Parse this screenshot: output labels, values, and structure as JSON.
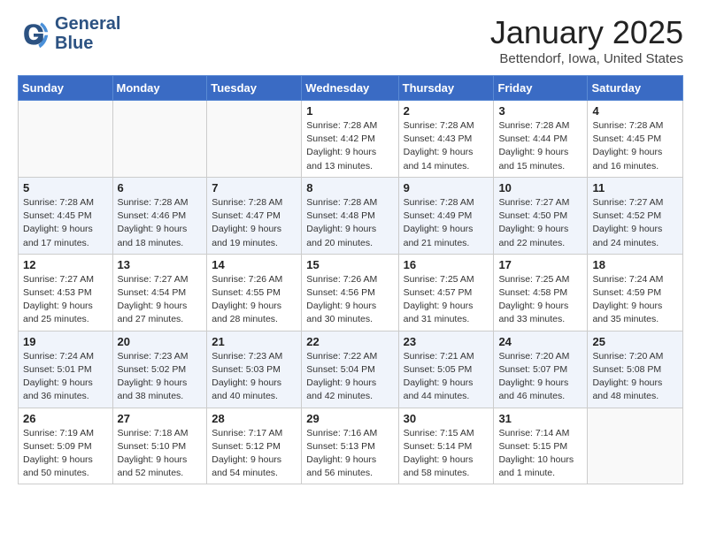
{
  "header": {
    "logo_line1": "General",
    "logo_line2": "Blue",
    "month": "January 2025",
    "location": "Bettendorf, Iowa, United States"
  },
  "weekdays": [
    "Sunday",
    "Monday",
    "Tuesday",
    "Wednesday",
    "Thursday",
    "Friday",
    "Saturday"
  ],
  "weeks": [
    [
      {
        "num": "",
        "info": ""
      },
      {
        "num": "",
        "info": ""
      },
      {
        "num": "",
        "info": ""
      },
      {
        "num": "1",
        "info": "Sunrise: 7:28 AM\nSunset: 4:42 PM\nDaylight: 9 hours\nand 13 minutes."
      },
      {
        "num": "2",
        "info": "Sunrise: 7:28 AM\nSunset: 4:43 PM\nDaylight: 9 hours\nand 14 minutes."
      },
      {
        "num": "3",
        "info": "Sunrise: 7:28 AM\nSunset: 4:44 PM\nDaylight: 9 hours\nand 15 minutes."
      },
      {
        "num": "4",
        "info": "Sunrise: 7:28 AM\nSunset: 4:45 PM\nDaylight: 9 hours\nand 16 minutes."
      }
    ],
    [
      {
        "num": "5",
        "info": "Sunrise: 7:28 AM\nSunset: 4:45 PM\nDaylight: 9 hours\nand 17 minutes."
      },
      {
        "num": "6",
        "info": "Sunrise: 7:28 AM\nSunset: 4:46 PM\nDaylight: 9 hours\nand 18 minutes."
      },
      {
        "num": "7",
        "info": "Sunrise: 7:28 AM\nSunset: 4:47 PM\nDaylight: 9 hours\nand 19 minutes."
      },
      {
        "num": "8",
        "info": "Sunrise: 7:28 AM\nSunset: 4:48 PM\nDaylight: 9 hours\nand 20 minutes."
      },
      {
        "num": "9",
        "info": "Sunrise: 7:28 AM\nSunset: 4:49 PM\nDaylight: 9 hours\nand 21 minutes."
      },
      {
        "num": "10",
        "info": "Sunrise: 7:27 AM\nSunset: 4:50 PM\nDaylight: 9 hours\nand 22 minutes."
      },
      {
        "num": "11",
        "info": "Sunrise: 7:27 AM\nSunset: 4:52 PM\nDaylight: 9 hours\nand 24 minutes."
      }
    ],
    [
      {
        "num": "12",
        "info": "Sunrise: 7:27 AM\nSunset: 4:53 PM\nDaylight: 9 hours\nand 25 minutes."
      },
      {
        "num": "13",
        "info": "Sunrise: 7:27 AM\nSunset: 4:54 PM\nDaylight: 9 hours\nand 27 minutes."
      },
      {
        "num": "14",
        "info": "Sunrise: 7:26 AM\nSunset: 4:55 PM\nDaylight: 9 hours\nand 28 minutes."
      },
      {
        "num": "15",
        "info": "Sunrise: 7:26 AM\nSunset: 4:56 PM\nDaylight: 9 hours\nand 30 minutes."
      },
      {
        "num": "16",
        "info": "Sunrise: 7:25 AM\nSunset: 4:57 PM\nDaylight: 9 hours\nand 31 minutes."
      },
      {
        "num": "17",
        "info": "Sunrise: 7:25 AM\nSunset: 4:58 PM\nDaylight: 9 hours\nand 33 minutes."
      },
      {
        "num": "18",
        "info": "Sunrise: 7:24 AM\nSunset: 4:59 PM\nDaylight: 9 hours\nand 35 minutes."
      }
    ],
    [
      {
        "num": "19",
        "info": "Sunrise: 7:24 AM\nSunset: 5:01 PM\nDaylight: 9 hours\nand 36 minutes."
      },
      {
        "num": "20",
        "info": "Sunrise: 7:23 AM\nSunset: 5:02 PM\nDaylight: 9 hours\nand 38 minutes."
      },
      {
        "num": "21",
        "info": "Sunrise: 7:23 AM\nSunset: 5:03 PM\nDaylight: 9 hours\nand 40 minutes."
      },
      {
        "num": "22",
        "info": "Sunrise: 7:22 AM\nSunset: 5:04 PM\nDaylight: 9 hours\nand 42 minutes."
      },
      {
        "num": "23",
        "info": "Sunrise: 7:21 AM\nSunset: 5:05 PM\nDaylight: 9 hours\nand 44 minutes."
      },
      {
        "num": "24",
        "info": "Sunrise: 7:20 AM\nSunset: 5:07 PM\nDaylight: 9 hours\nand 46 minutes."
      },
      {
        "num": "25",
        "info": "Sunrise: 7:20 AM\nSunset: 5:08 PM\nDaylight: 9 hours\nand 48 minutes."
      }
    ],
    [
      {
        "num": "26",
        "info": "Sunrise: 7:19 AM\nSunset: 5:09 PM\nDaylight: 9 hours\nand 50 minutes."
      },
      {
        "num": "27",
        "info": "Sunrise: 7:18 AM\nSunset: 5:10 PM\nDaylight: 9 hours\nand 52 minutes."
      },
      {
        "num": "28",
        "info": "Sunrise: 7:17 AM\nSunset: 5:12 PM\nDaylight: 9 hours\nand 54 minutes."
      },
      {
        "num": "29",
        "info": "Sunrise: 7:16 AM\nSunset: 5:13 PM\nDaylight: 9 hours\nand 56 minutes."
      },
      {
        "num": "30",
        "info": "Sunrise: 7:15 AM\nSunset: 5:14 PM\nDaylight: 9 hours\nand 58 minutes."
      },
      {
        "num": "31",
        "info": "Sunrise: 7:14 AM\nSunset: 5:15 PM\nDaylight: 10 hours\nand 1 minute."
      },
      {
        "num": "",
        "info": ""
      }
    ]
  ]
}
